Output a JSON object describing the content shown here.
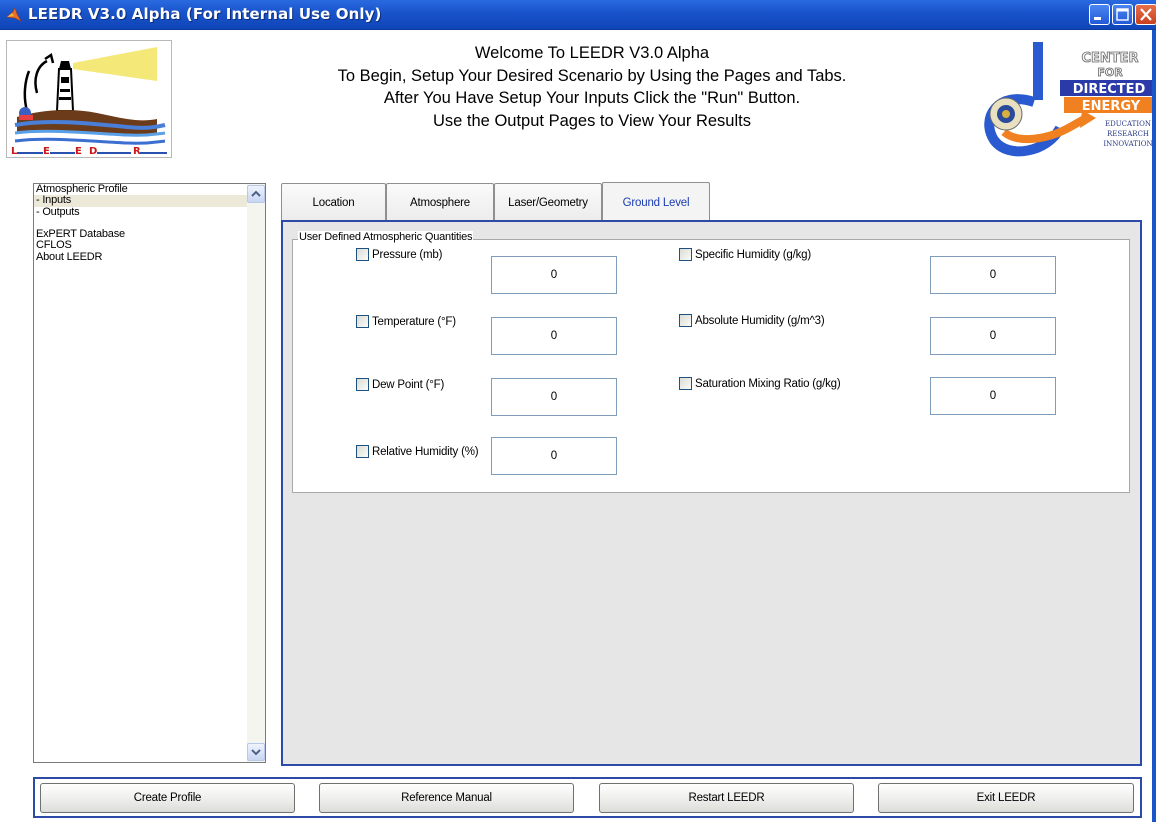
{
  "window": {
    "title": "LEEDR V3.0 Alpha (For Internal Use Only)"
  },
  "header": {
    "welcome_lines": [
      "Welcome To LEEDR V3.0 Alpha",
      "To Begin, Setup Your Desired Scenario by Using the Pages and Tabs.",
      "After You Have Setup Your Inputs Click the \"Run\" Button.",
      "Use the Output Pages to View Your Results"
    ],
    "logo_left": {
      "letters": [
        "L",
        "E",
        "E",
        "D",
        "R"
      ]
    },
    "logo_right": {
      "line1": "CENTER",
      "line2": "FOR",
      "line3": "DIRECTED",
      "line4": "ENERGY",
      "tagline": [
        "EDUCATION",
        "RESEARCH",
        "INNOVATION"
      ]
    }
  },
  "nav": {
    "items": [
      {
        "label": "Atmospheric Profile",
        "selected": false
      },
      {
        "label": "- Inputs",
        "selected": true
      },
      {
        "label": "- Outputs",
        "selected": false
      },
      {
        "label": "",
        "selected": false
      },
      {
        "label": "ExPERT Database",
        "selected": false
      },
      {
        "label": "CFLOS",
        "selected": false
      },
      {
        "label": "About LEEDR",
        "selected": false
      }
    ]
  },
  "tabs": [
    {
      "label": "Location",
      "active": false
    },
    {
      "label": "Atmosphere",
      "active": false
    },
    {
      "label": "Laser/Geometry",
      "active": false
    },
    {
      "label": "Ground Level",
      "active": true
    }
  ],
  "group": {
    "legend": "User Defined Atmospheric Quantities",
    "fields_left": [
      {
        "label": "Pressure (mb)",
        "value": "0",
        "checked": false
      },
      {
        "label": "Temperature (°F)",
        "value": "0",
        "checked": false
      },
      {
        "label": "Dew Point (°F)",
        "value": "0",
        "checked": false
      },
      {
        "label": "Relative Humidity (%)",
        "value": "0",
        "checked": false
      }
    ],
    "fields_right": [
      {
        "label": "Specific Humidity (g/kg)",
        "value": "0",
        "checked": false
      },
      {
        "label": "Absolute Humidity (g/m^3)",
        "value": "0",
        "checked": false
      },
      {
        "label": "Saturation Mixing Ratio (g/kg)",
        "value": "0",
        "checked": false
      }
    ]
  },
  "buttons": {
    "create": "Create Profile",
    "manual": "Reference Manual",
    "restart": "Restart LEEDR",
    "exit": "Exit LEEDR"
  },
  "colors": {
    "titlebar": "#1a55cc",
    "panel_border": "#2c4aa6",
    "panel_bg": "#e6e6e6",
    "active_tab_text": "#1a3cb0"
  }
}
